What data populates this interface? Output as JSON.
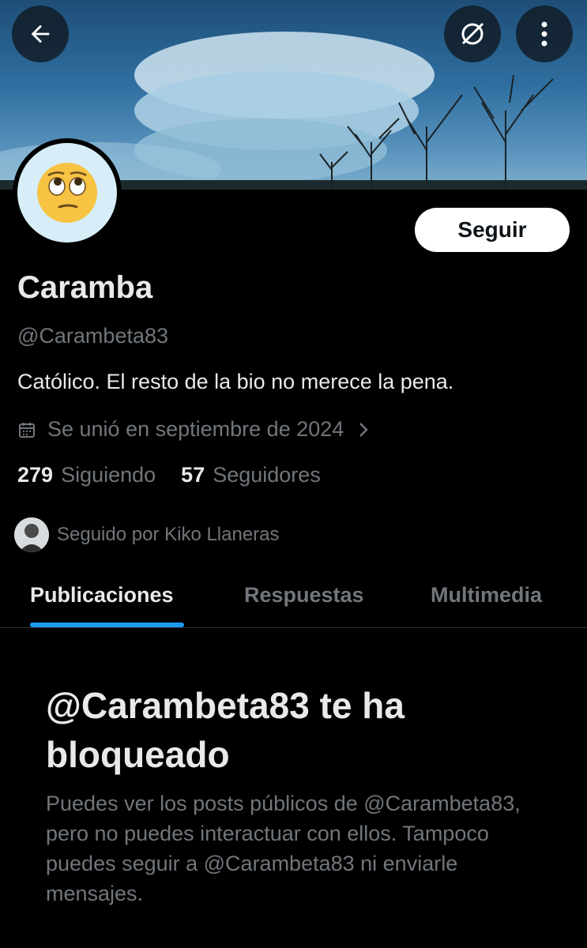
{
  "header": {
    "back_icon": "arrow-left-icon",
    "grok_icon": "grok-icon",
    "more_icon": "more-vertical-icon"
  },
  "profile": {
    "avatar_icon": "face-with-rolling-eyes-emoji",
    "name": "Caramba",
    "handle": "@Carambeta83",
    "bio": "Católico. El resto de la bio no merece la pena.",
    "joined": "Se unió en septiembre de 2024",
    "following_count": "279",
    "following_label": "Siguiendo",
    "followers_count": "57",
    "followers_label": "Seguidores",
    "followed_by": "Seguido por Kiko Llaneras"
  },
  "actions": {
    "follow_label": "Seguir"
  },
  "tabs": [
    {
      "label": "Publicaciones",
      "active": true
    },
    {
      "label": "Respuestas",
      "active": false
    },
    {
      "label": "Multimedia",
      "active": false
    }
  ],
  "blocked": {
    "title": "@Carambeta83 te ha bloqueado",
    "text": "Puedes ver los posts públicos de @Carambeta83, pero no puedes interactuar con ellos. Tampoco puedes seguir a @Carambeta83 ni enviarle mensajes."
  },
  "colors": {
    "accent": "#1d9bf0",
    "background": "#000000",
    "text_primary": "#e7e9ea",
    "text_secondary": "#71767b"
  }
}
